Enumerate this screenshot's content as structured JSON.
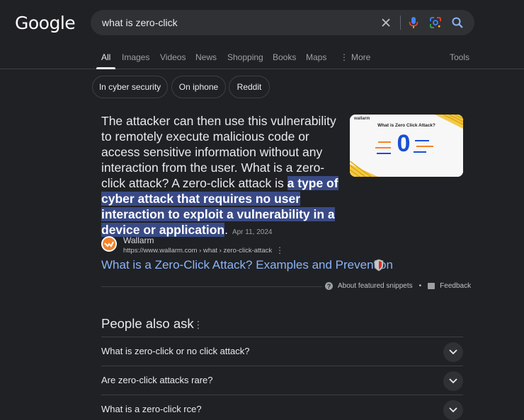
{
  "logo": "Google",
  "search": {
    "query": "what is zero-click"
  },
  "tabs": [
    {
      "label": "All"
    },
    {
      "label": "Images"
    },
    {
      "label": "Videos"
    },
    {
      "label": "News"
    },
    {
      "label": "Shopping"
    },
    {
      "label": "Books"
    },
    {
      "label": "Maps"
    },
    {
      "label": "More"
    }
  ],
  "tools_label": "Tools",
  "chips": [
    {
      "label": "In cyber security"
    },
    {
      "label": "On iphone"
    },
    {
      "label": "Reddit"
    }
  ],
  "featured": {
    "text_before": "The attacker can then use this vulnerability to remotely execute malicious code or access sensitive information without any interaction from the user. What is a zero-click attack? A zero-click attack is ",
    "highlight": "a type of cyber attack that requires no user interaction to exploit a vulnerability in a device or application",
    "text_after": ".",
    "date": "Apr 11, 2024",
    "thumbnail": {
      "brand": "wallarm",
      "title": "What is Zero Click Attack?",
      "big_char": "0"
    }
  },
  "source": {
    "name": "Wallarm",
    "url": "https://www.wallarm.com › what › zero-click-attack",
    "title": "What is a Zero-Click Attack? Examples and Prevention"
  },
  "about": {
    "about_label": "About featured snippets",
    "bullet": "•",
    "feedback_label": "Feedback"
  },
  "people_also_ask": {
    "title": "People also ask",
    "questions": [
      "What is zero-click or no click attack?",
      "Are zero-click attacks rare?",
      "What is a zero-click rce?"
    ]
  },
  "colors": {
    "background": "#202124",
    "link": "#8ab4f8",
    "highlight": "#394a86",
    "wallarm_orange": "#f5832a"
  }
}
